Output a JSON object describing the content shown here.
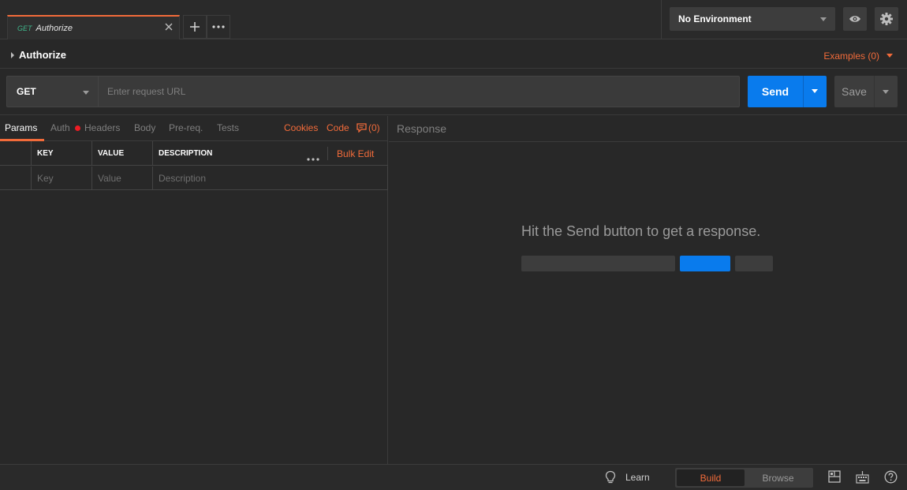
{
  "tabbar": {
    "tab": {
      "method": "GET",
      "title": "Authorize"
    },
    "environment": {
      "selected": "No Environment"
    }
  },
  "request": {
    "name": "Authorize",
    "examples_label": "Examples (0)",
    "method": "GET",
    "url_value": "",
    "url_placeholder": "Enter request URL",
    "send_label": "Send",
    "save_label": "Save"
  },
  "subtabs": {
    "items": [
      "Params",
      "Auth",
      "Headers",
      "Body",
      "Pre-req.",
      "Tests"
    ],
    "active": "Params",
    "cookies_label": "Cookies",
    "code_label": "Code",
    "comments_count": "(0)"
  },
  "params_table": {
    "headers": [
      "KEY",
      "VALUE",
      "DESCRIPTION"
    ],
    "placeholders": [
      "Key",
      "Value",
      "Description"
    ],
    "bulk_edit_label": "Bulk Edit"
  },
  "response": {
    "header": "Response",
    "empty_message": "Hit the Send button to get a response."
  },
  "statusbar": {
    "learn_label": "Learn",
    "modes": [
      "Build",
      "Browse"
    ],
    "active_mode": "Build"
  },
  "colors": {
    "accent_orange": "#f26b3a",
    "primary_blue": "#097bed",
    "method_green": "#3fb68b",
    "alert_red": "#ed1c24"
  }
}
